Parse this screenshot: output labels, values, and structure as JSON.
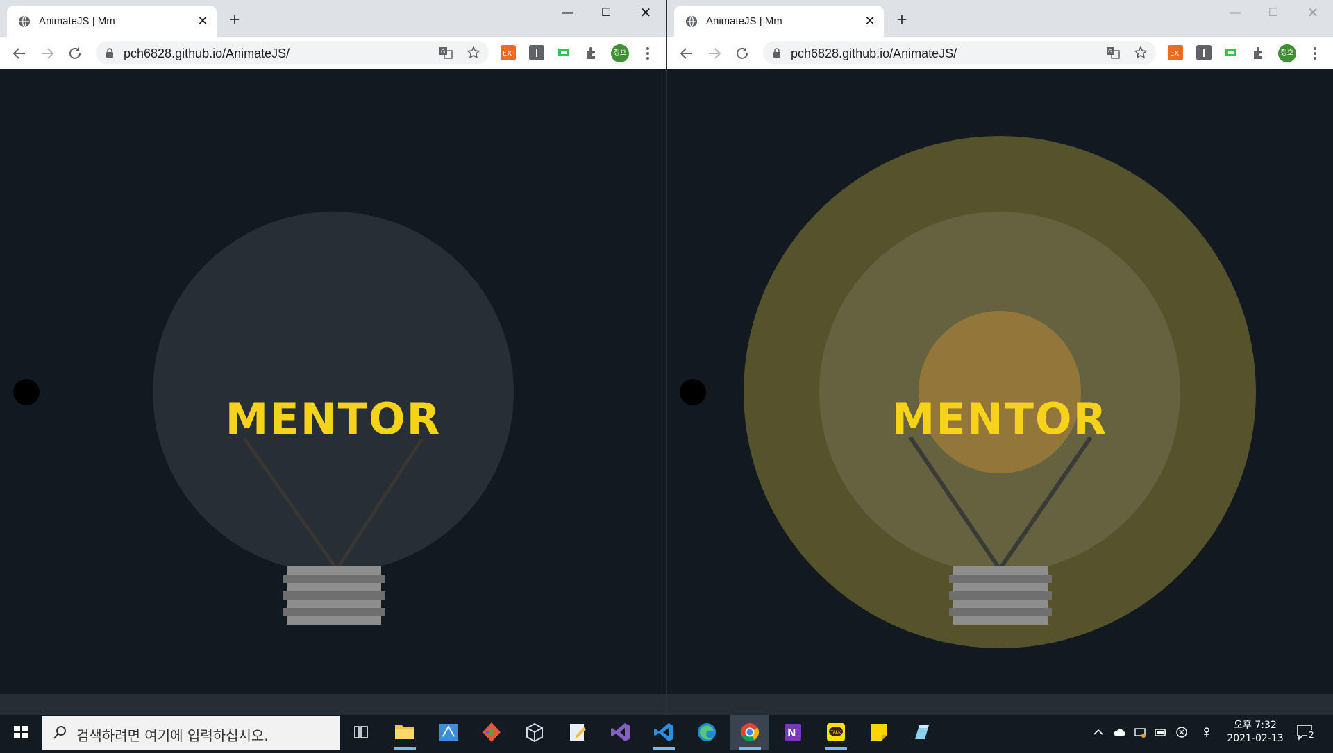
{
  "browser": {
    "tab_title": "AnimateJS | Mm",
    "url": "pch6828.github.io/AnimateJS/",
    "profile_initials": "정호"
  },
  "page": {
    "logo_text": "MENTOR",
    "left_state": "off",
    "right_state": "on",
    "colors": {
      "background": "#121920",
      "bulb_off": "#272e35",
      "glow_outer": "#54532b",
      "glow_middle": "#64623f",
      "glow_core": "#93773a",
      "text": "#f6d31a",
      "socket": "#8a8a8a"
    }
  },
  "taskbar": {
    "search_placeholder": "검색하려면 여기에 입력하십시오.",
    "clock_time": "오후 7:32",
    "clock_date": "2021-02-13",
    "notification_count": "2",
    "apps": [
      "task-view",
      "file-explorer",
      "remote-desktop",
      "git",
      "virtualbox",
      "notepad",
      "visual-studio",
      "vscode",
      "edge",
      "chrome",
      "onenote",
      "kakaotalk",
      "sticky-notes",
      "pen-app"
    ]
  }
}
